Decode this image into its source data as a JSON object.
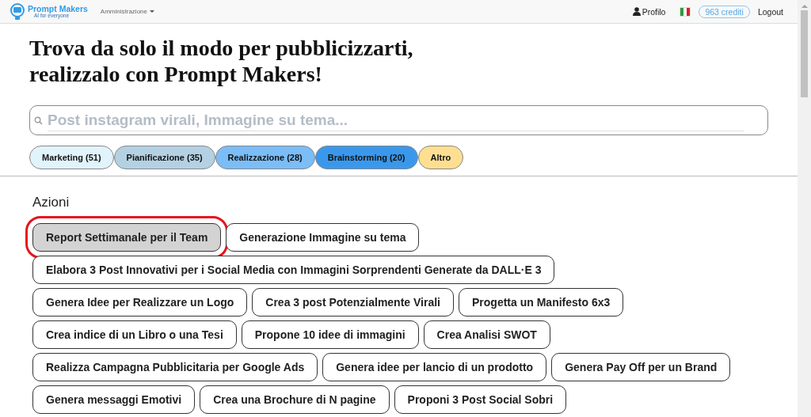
{
  "header": {
    "brand": "Prompt Makers",
    "tagline": "AI for everyone",
    "menu": "Amministrazione",
    "profile": "Profilo",
    "credits": "963 crediti",
    "logout": "Logout"
  },
  "headline": [
    "Trova da solo il modo per pubblicizzarti,",
    "realizzalo con Prompt Makers!"
  ],
  "search": {
    "placeholder": "Post instagram virali, Immagine su tema..."
  },
  "categories": [
    {
      "label": "Marketing (51)",
      "color": "#e1f3fb"
    },
    {
      "label": "Pianificazione (35)",
      "color": "#b3d1e3"
    },
    {
      "label": "Realizzazione (28)",
      "color": "#7bbdf7"
    },
    {
      "label": "Brainstorming (20)",
      "color": "#3a98ec"
    },
    {
      "label": "Altro",
      "color": "#fedf92"
    }
  ],
  "section_title": "Azioni",
  "actions": [
    [
      {
        "label": "Report Settimanale per il Team",
        "selected": true
      },
      {
        "label": "Generazione Immagine su tema",
        "selected": false
      }
    ],
    [
      {
        "label": "Elabora 3 Post Innovativi per i Social Media con Immagini Sorprendenti Generate da DALL·E 3",
        "selected": false
      }
    ],
    [
      {
        "label": "Genera Idee per Realizzare un Logo",
        "selected": false
      },
      {
        "label": "Crea 3 post Potenzialmente Virali",
        "selected": false
      },
      {
        "label": "Progetta un Manifesto 6x3",
        "selected": false
      }
    ],
    [
      {
        "label": "Crea indice di un Libro o una Tesi",
        "selected": false
      },
      {
        "label": "Propone 10 idee di immagini",
        "selected": false
      },
      {
        "label": "Crea Analisi SWOT",
        "selected": false
      }
    ],
    [
      {
        "label": "Realizza Campagna Pubblicitaria per Google Ads",
        "selected": false
      },
      {
        "label": "Genera idee per lancio di un prodotto",
        "selected": false
      },
      {
        "label": "Genera Pay Off per un Brand",
        "selected": false
      }
    ],
    [
      {
        "label": "Genera messaggi Emotivi",
        "selected": false
      },
      {
        "label": "Crea una Brochure di N pagine",
        "selected": false
      },
      {
        "label": "Proponi 3 Post Social Sobri",
        "selected": false
      }
    ]
  ]
}
